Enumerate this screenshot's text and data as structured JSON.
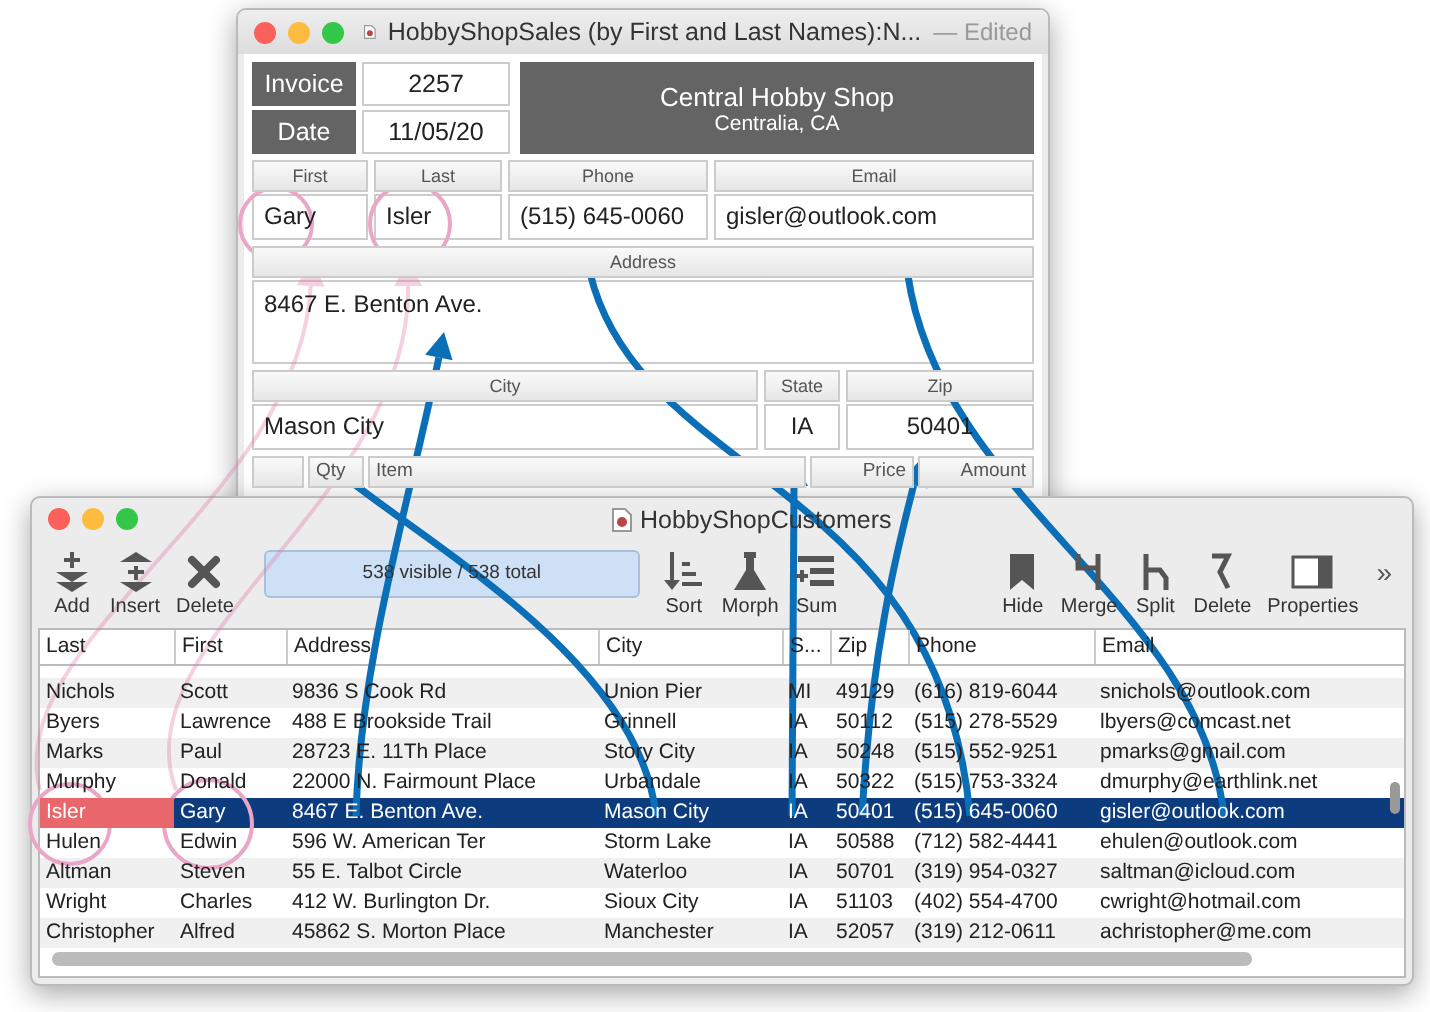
{
  "sales_window": {
    "title": "HobbyShopSales (by First and Last Names):N...",
    "status": "— Edited",
    "invoice_label": "Invoice",
    "invoice": "2257",
    "date_label": "Date",
    "date": "11/05/20",
    "shop_name": "Central Hobby Shop",
    "shop_city": "Centralia, CA",
    "field_rows": [
      [
        {
          "label": "First",
          "value": "Gary"
        },
        {
          "label": "Last",
          "value": "Isler"
        },
        {
          "label": "Phone",
          "value": "(515) 645-0060"
        },
        {
          "label": "Email",
          "value": "gisler@outlook.com"
        }
      ],
      [
        {
          "label": "Address",
          "value": "8467 E. Benton Ave."
        }
      ],
      [
        {
          "label": "City",
          "value": "Mason City"
        },
        {
          "label": "State",
          "value": "IA"
        },
        {
          "label": "Zip",
          "value": "50401"
        }
      ]
    ],
    "line_item_columns": [
      "Qty",
      "Item",
      "Price",
      "Amount"
    ]
  },
  "customers_window": {
    "title": "HobbyShopCustomers",
    "record_count": "538 visible / 538 total",
    "overflow": "»",
    "toolbar_left": [
      {
        "label": "Add",
        "kind": "add"
      },
      {
        "label": "Insert",
        "kind": "insert"
      },
      {
        "label": "Delete",
        "kind": "delete"
      }
    ],
    "toolbar_mid": [
      {
        "label": "Sort",
        "kind": "sort"
      },
      {
        "label": "Morph",
        "kind": "morph"
      },
      {
        "label": "Sum",
        "kind": "sum"
      }
    ],
    "toolbar_right": [
      {
        "label": "Hide",
        "kind": "hide"
      },
      {
        "label": "Merge",
        "kind": "merge"
      },
      {
        "label": "Split",
        "kind": "split"
      },
      {
        "label": "Delete",
        "kind": "unlink"
      },
      {
        "label": "Properties",
        "kind": "properties"
      }
    ],
    "columns": [
      "Last",
      "First",
      "Address",
      "City",
      "S...",
      "Zip",
      "Phone",
      "Email"
    ],
    "rows": [
      {
        "cells": [
          "Nichols",
          "Scott",
          "9836 S Cook Rd",
          "Union Pier",
          "MI",
          "49129",
          "(616) 819-6044",
          "snichols@outlook.com"
        ],
        "selected": false,
        "first_cell_active": false
      },
      {
        "cells": [
          "Byers",
          "Lawrence",
          "488 E Brookside Trail",
          "Grinnell",
          "IA",
          "50112",
          "(515) 278-5529",
          "lbyers@comcast.net"
        ],
        "selected": false,
        "first_cell_active": false
      },
      {
        "cells": [
          "Marks",
          "Paul",
          "28723 E. 11Th Place",
          "Story City",
          "IA",
          "50248",
          "(515) 552-9251",
          "pmarks@gmail.com"
        ],
        "selected": false,
        "first_cell_active": false
      },
      {
        "cells": [
          "Murphy",
          "Donald",
          "22000 N. Fairmount Place",
          "Urbandale",
          "IA",
          "50322",
          "(515) 753-3324",
          "dmurphy@earthlink.net"
        ],
        "selected": false,
        "first_cell_active": false
      },
      {
        "cells": [
          "Isler",
          "Gary",
          "8467 E. Benton Ave.",
          "Mason City",
          "IA",
          "50401",
          "(515) 645-0060",
          "gisler@outlook.com"
        ],
        "selected": true,
        "first_cell_active": true
      },
      {
        "cells": [
          "Hulen",
          "Edwin",
          "596 W. American Ter",
          "Storm Lake",
          "IA",
          "50588",
          "(712) 582-4441",
          "ehulen@outlook.com"
        ],
        "selected": false,
        "first_cell_active": false
      },
      {
        "cells": [
          "Altman",
          "Steven",
          "55 E. Talbot Circle",
          "Waterloo",
          "IA",
          "50701",
          "(319) 954-0327",
          "saltman@icloud.com"
        ],
        "selected": false,
        "first_cell_active": false
      },
      {
        "cells": [
          "Wright",
          "Charles",
          "412 W. Burlington Dr.",
          "Sioux City",
          "IA",
          "51103",
          "(402) 554-4700",
          "cwright@hotmail.com"
        ],
        "selected": false,
        "first_cell_active": false
      },
      {
        "cells": [
          "Christopher",
          "Alfred",
          "45862 S. Morton Place",
          "Manchester",
          "IA",
          "52057",
          "(319) 212-0611",
          "achristopher@me.com"
        ],
        "selected": false,
        "first_cell_active": false
      }
    ]
  }
}
